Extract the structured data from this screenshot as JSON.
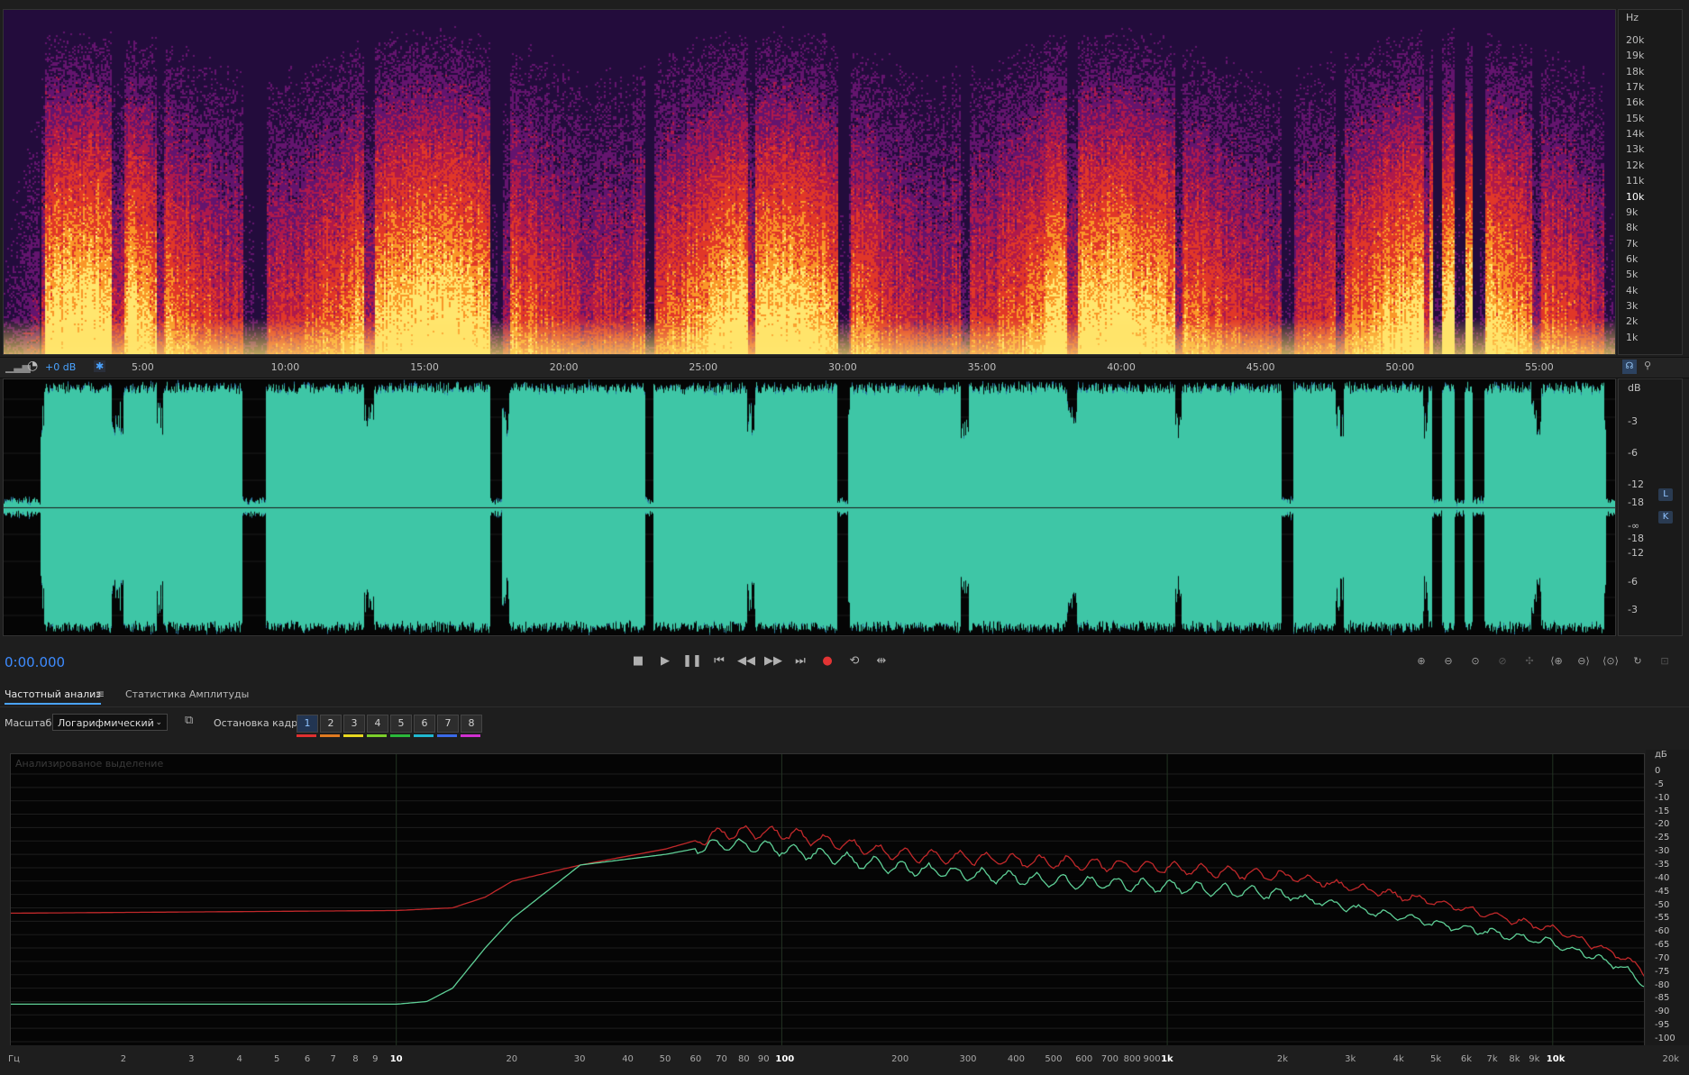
{
  "spectral": {
    "unit": "Hz",
    "freq_labels": [
      "20k",
      "19k",
      "18k",
      "17k",
      "16k",
      "15k",
      "14k",
      "13k",
      "12k",
      "11k",
      "10k",
      "9k",
      "8k",
      "7k",
      "6k",
      "5k",
      "4k",
      "3k",
      "2k",
      "1k"
    ],
    "colors": {
      "low": "#f9d84a",
      "mid": "#e6452a",
      "high": "#7b1b78",
      "top": "#1a0b30"
    }
  },
  "timeline": {
    "gain": "+0 dB",
    "labels": [
      "5:00",
      "10:00",
      "15:00",
      "20:00",
      "25:00",
      "30:00",
      "35:00",
      "40:00",
      "45:00",
      "50:00",
      "55:00"
    ]
  },
  "waveform": {
    "unit": "dB",
    "db_labels_top": [
      "-3",
      "-6",
      "-12",
      "-18",
      "-∞"
    ],
    "db_labels_bottom": [
      "-18",
      "-12",
      "-6",
      "-3"
    ],
    "channels": [
      "L",
      "K"
    ],
    "color": "#3ec6a6"
  },
  "transport": {
    "current_time": "0:00.000",
    "buttons": [
      {
        "name": "stop-icon",
        "glyph": "■"
      },
      {
        "name": "play-icon",
        "glyph": "▶"
      },
      {
        "name": "pause-icon",
        "glyph": "❚❚"
      },
      {
        "name": "skip-start-icon",
        "glyph": "⏮"
      },
      {
        "name": "rewind-icon",
        "glyph": "◀◀"
      },
      {
        "name": "fast-forward-icon",
        "glyph": "▶▶"
      },
      {
        "name": "skip-end-icon",
        "glyph": "⏭"
      },
      {
        "name": "record-icon",
        "glyph": "●"
      },
      {
        "name": "loop-icon",
        "glyph": "⟲"
      },
      {
        "name": "skip-selection-icon",
        "glyph": "⇹"
      }
    ],
    "zoom_buttons": [
      {
        "name": "zoom-in-amplitude-icon",
        "glyph": "⊕"
      },
      {
        "name": "zoom-out-amplitude-icon",
        "glyph": "⊖"
      },
      {
        "name": "zoom-reset-amplitude-icon",
        "glyph": "⊙"
      },
      {
        "name": "zoom-selection-disabled-icon",
        "glyph": "⊘"
      },
      {
        "name": "zoom-fit-disabled-icon",
        "glyph": "✣"
      },
      {
        "name": "zoom-in-time-icon",
        "glyph": "⟨⊕"
      },
      {
        "name": "zoom-out-time-icon",
        "glyph": "⊖⟩"
      },
      {
        "name": "zoom-full-icon",
        "glyph": "⟨⊙⟩"
      },
      {
        "name": "zoom-selection-icon",
        "glyph": "↻"
      },
      {
        "name": "zoom-disabled-icon",
        "glyph": "⊡"
      }
    ]
  },
  "freq_panel": {
    "tabs": [
      "Частотный анализ",
      "Статистика Амплитуды"
    ],
    "scale_label": "Масштаб:",
    "scale_value": "Логарифмический",
    "frame_label": "Остановка кадра:",
    "frames": [
      "1",
      "2",
      "3",
      "4",
      "5",
      "6",
      "7",
      "8"
    ],
    "frame_colors": [
      "#e03030",
      "#e07a20",
      "#e8d820",
      "#7ccf2a",
      "#2ab83a",
      "#20b8d0",
      "#3a6ae8",
      "#d030d0"
    ],
    "graph_caption": "Анализированое выделение",
    "y_unit": "дБ",
    "y_labels": [
      "0",
      "-5",
      "-10",
      "-15",
      "-20",
      "-25",
      "-30",
      "-35",
      "-40",
      "-45",
      "-50",
      "-55",
      "-60",
      "-65",
      "-70",
      "-75",
      "-80",
      "-85",
      "-90",
      "-95",
      "-100"
    ],
    "x_labels": [
      {
        "t": "Гц",
        "f": 1,
        "b": false
      },
      {
        "t": "2",
        "f": 2,
        "b": false
      },
      {
        "t": "3",
        "f": 3,
        "b": false
      },
      {
        "t": "4",
        "f": 4,
        "b": false
      },
      {
        "t": "5",
        "f": 5,
        "b": false
      },
      {
        "t": "6",
        "f": 6,
        "b": false
      },
      {
        "t": "7",
        "f": 7,
        "b": false
      },
      {
        "t": "8",
        "f": 8,
        "b": false
      },
      {
        "t": "9",
        "f": 9,
        "b": false
      },
      {
        "t": "10",
        "f": 10,
        "b": true
      },
      {
        "t": "20",
        "f": 20,
        "b": false
      },
      {
        "t": "30",
        "f": 30,
        "b": false
      },
      {
        "t": "40",
        "f": 40,
        "b": false
      },
      {
        "t": "50",
        "f": 50,
        "b": false
      },
      {
        "t": "60",
        "f": 60,
        "b": false
      },
      {
        "t": "70",
        "f": 70,
        "b": false
      },
      {
        "t": "80",
        "f": 80,
        "b": false
      },
      {
        "t": "90",
        "f": 90,
        "b": false
      },
      {
        "t": "100",
        "f": 100,
        "b": true
      },
      {
        "t": "200",
        "f": 200,
        "b": false
      },
      {
        "t": "300",
        "f": 300,
        "b": false
      },
      {
        "t": "400",
        "f": 400,
        "b": false
      },
      {
        "t": "500",
        "f": 500,
        "b": false
      },
      {
        "t": "600",
        "f": 600,
        "b": false
      },
      {
        "t": "700",
        "f": 700,
        "b": false
      },
      {
        "t": "800",
        "f": 800,
        "b": false
      },
      {
        "t": "900",
        "f": 900,
        "b": false
      },
      {
        "t": "1k",
        "f": 1000,
        "b": true
      },
      {
        "t": "2k",
        "f": 2000,
        "b": false
      },
      {
        "t": "3k",
        "f": 3000,
        "b": false
      },
      {
        "t": "4k",
        "f": 4000,
        "b": false
      },
      {
        "t": "5k",
        "f": 5000,
        "b": false
      },
      {
        "t": "6k",
        "f": 6000,
        "b": false
      },
      {
        "t": "7k",
        "f": 7000,
        "b": false
      },
      {
        "t": "8k",
        "f": 8000,
        "b": false
      },
      {
        "t": "9k",
        "f": 9000,
        "b": false
      },
      {
        "t": "10k",
        "f": 10000,
        "b": true
      },
      {
        "t": "20k",
        "f": 20000,
        "b": false
      }
    ],
    "series": [
      {
        "color": "#c0282a",
        "points": [
          [
            1,
            -52
          ],
          [
            10,
            -51
          ],
          [
            14,
            -50
          ],
          [
            17,
            -46
          ],
          [
            20,
            -40
          ],
          [
            30,
            -34
          ],
          [
            50,
            -28
          ],
          [
            70,
            -22
          ],
          [
            100,
            -22
          ],
          [
            200,
            -30
          ],
          [
            500,
            -33
          ],
          [
            1000,
            -35
          ],
          [
            2000,
            -38
          ],
          [
            3000,
            -42
          ],
          [
            5000,
            -48
          ],
          [
            10000,
            -58
          ],
          [
            15000,
            -68
          ],
          [
            20000,
            -80
          ],
          [
            22000,
            -85
          ]
        ]
      },
      {
        "color": "#5ecf96",
        "points": [
          [
            1,
            -86
          ],
          [
            10,
            -86
          ],
          [
            12,
            -85
          ],
          [
            14,
            -80
          ],
          [
            17,
            -65
          ],
          [
            20,
            -54
          ],
          [
            30,
            -34
          ],
          [
            50,
            -30
          ],
          [
            70,
            -26
          ],
          [
            100,
            -28
          ],
          [
            200,
            -35
          ],
          [
            500,
            -40
          ],
          [
            1000,
            -42
          ],
          [
            2000,
            -45
          ],
          [
            3000,
            -50
          ],
          [
            5000,
            -56
          ],
          [
            10000,
            -63
          ],
          [
            15000,
            -72
          ],
          [
            20000,
            -84
          ],
          [
            22000,
            -96
          ]
        ]
      }
    ]
  }
}
